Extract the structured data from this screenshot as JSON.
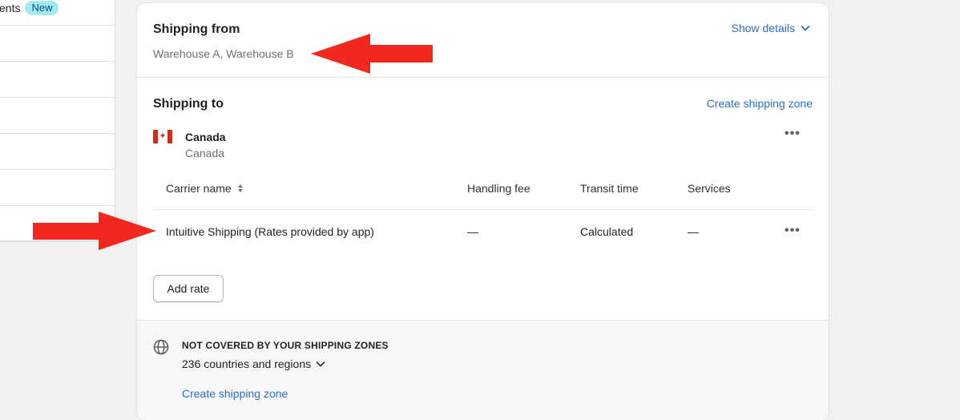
{
  "sidebar": {
    "partial_label": "ents",
    "badge": "New"
  },
  "shipping_from": {
    "title": "Shipping from",
    "locations": "Warehouse A, Warehouse B",
    "show_details_label": "Show details"
  },
  "shipping_to": {
    "title": "Shipping to",
    "create_zone_label": "Create shipping zone",
    "zone": {
      "name": "Canada",
      "countries": "Canada",
      "flag_icon": "canada-flag-icon"
    },
    "table": {
      "headers": [
        "Carrier name",
        "Handling fee",
        "Transit time",
        "Services"
      ],
      "rows": [
        {
          "carrier": "Intuitive Shipping (Rates provided by app)",
          "handling_fee": "—",
          "transit_time": "Calculated",
          "services": "—"
        }
      ]
    },
    "add_rate_label": "Add rate"
  },
  "not_covered": {
    "title": "NOT COVERED BY YOUR SHIPPING ZONES",
    "summary": "236 countries and regions",
    "create_zone_label": "Create shipping zone",
    "icon": "globe-icon"
  },
  "colors": {
    "link": "#2c6ecb",
    "annotation_arrow": "#f0281d",
    "badge_bg": "#a4e8f2"
  }
}
